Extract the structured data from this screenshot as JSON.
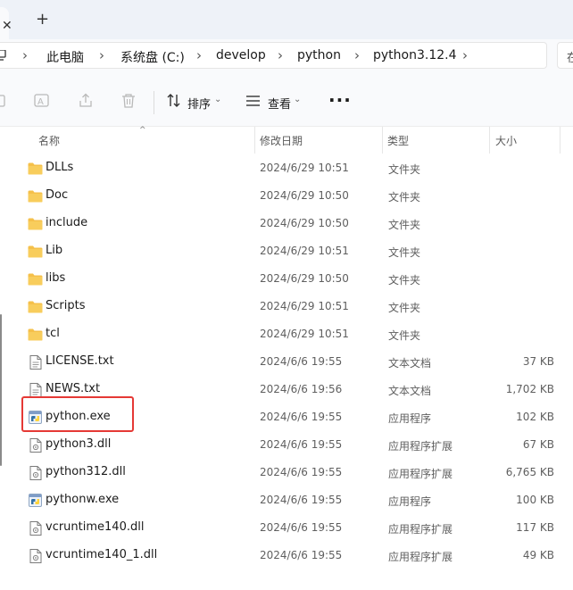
{
  "tabbar": {
    "close_glyph": "✕",
    "add_glyph": "+"
  },
  "breadcrumb": [
    "此电脑",
    "系统盘 (C:)",
    "develop",
    "python",
    "python3.12.4"
  ],
  "search_edge_glyph": "在",
  "toolbar": {
    "sort_label": "排序",
    "view_label": "查看",
    "more_label": "···"
  },
  "columns": {
    "name": "名称",
    "modified": "修改日期",
    "type": "类型",
    "size": "大小"
  },
  "files": [
    {
      "name": "DLLs",
      "modified": "2024/6/29 10:51",
      "type": "文件夹",
      "size": "",
      "icon": "folder-icon"
    },
    {
      "name": "Doc",
      "modified": "2024/6/29 10:50",
      "type": "文件夹",
      "size": "",
      "icon": "folder-icon"
    },
    {
      "name": "include",
      "modified": "2024/6/29 10:50",
      "type": "文件夹",
      "size": "",
      "icon": "folder-icon"
    },
    {
      "name": "Lib",
      "modified": "2024/6/29 10:51",
      "type": "文件夹",
      "size": "",
      "icon": "folder-icon"
    },
    {
      "name": "libs",
      "modified": "2024/6/29 10:50",
      "type": "文件夹",
      "size": "",
      "icon": "folder-icon"
    },
    {
      "name": "Scripts",
      "modified": "2024/6/29 10:51",
      "type": "文件夹",
      "size": "",
      "icon": "folder-icon"
    },
    {
      "name": "tcl",
      "modified": "2024/6/29 10:51",
      "type": "文件夹",
      "size": "",
      "icon": "folder-icon"
    },
    {
      "name": "LICENSE.txt",
      "modified": "2024/6/6 19:55",
      "type": "文本文档",
      "size": "37 KB",
      "icon": "text-file-icon"
    },
    {
      "name": "NEWS.txt",
      "modified": "2024/6/6 19:56",
      "type": "文本文档",
      "size": "1,702 KB",
      "icon": "text-file-icon"
    },
    {
      "name": "python.exe",
      "modified": "2024/6/6 19:55",
      "type": "应用程序",
      "size": "102 KB",
      "icon": "python-exe-icon"
    },
    {
      "name": "python3.dll",
      "modified": "2024/6/6 19:55",
      "type": "应用程序扩展",
      "size": "67 KB",
      "icon": "dll-file-icon"
    },
    {
      "name": "python312.dll",
      "modified": "2024/6/6 19:55",
      "type": "应用程序扩展",
      "size": "6,765 KB",
      "icon": "dll-file-icon"
    },
    {
      "name": "pythonw.exe",
      "modified": "2024/6/6 19:55",
      "type": "应用程序",
      "size": "100 KB",
      "icon": "python-exe-icon"
    },
    {
      "name": "vcruntime140.dll",
      "modified": "2024/6/6 19:55",
      "type": "应用程序扩展",
      "size": "117 KB",
      "icon": "dll-file-icon"
    },
    {
      "name": "vcruntime140_1.dll",
      "modified": "2024/6/6 19:55",
      "type": "应用程序扩展",
      "size": "49 KB",
      "icon": "dll-file-icon"
    }
  ],
  "colors": {
    "folder": "#f5c04a",
    "highlight": "#e53935",
    "python_blue": "#3572a5",
    "python_yellow": "#ffd43b"
  }
}
